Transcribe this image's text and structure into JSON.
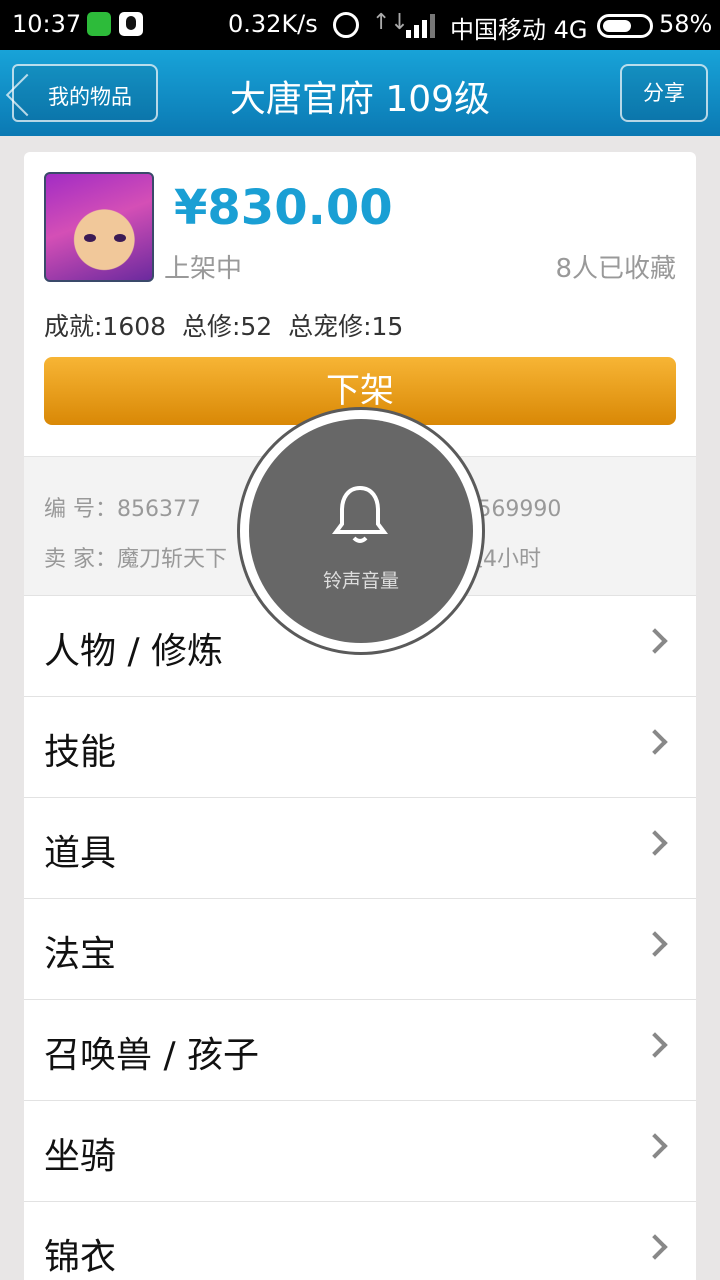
{
  "status_bar": {
    "time": "10:37",
    "speed": "0.32K/s",
    "data_arrows": "↑↓",
    "carrier": "中国移动 4G",
    "battery": "58%"
  },
  "header": {
    "back_label": "我的物品",
    "title": "大唐官府 109级",
    "share_label": "分享"
  },
  "item": {
    "price": "¥830.00",
    "status": "上架中",
    "favorites": "8人已收藏",
    "stats": "成就:1608  总修:52  总宠修:15",
    "delist_label": "下架"
  },
  "info": {
    "number": "编  号：856377",
    "seller_id": "卖家ID：31569990",
    "seller": "卖  家：魔刀斩天下",
    "remaining": "剩  余：13天4小时"
  },
  "menu": [
    {
      "label": "人物 / 修炼"
    },
    {
      "label": "技能"
    },
    {
      "label": "道具"
    },
    {
      "label": "法宝"
    },
    {
      "label": "召唤兽 / 孩子"
    },
    {
      "label": "坐骑"
    },
    {
      "label": "锦衣"
    }
  ],
  "volume_overlay": {
    "label": "铃声音量",
    "icon": "bell-icon"
  },
  "colors": {
    "accent": "#1a9fd4",
    "header": "#0b79b3",
    "button": "#e8980f"
  }
}
